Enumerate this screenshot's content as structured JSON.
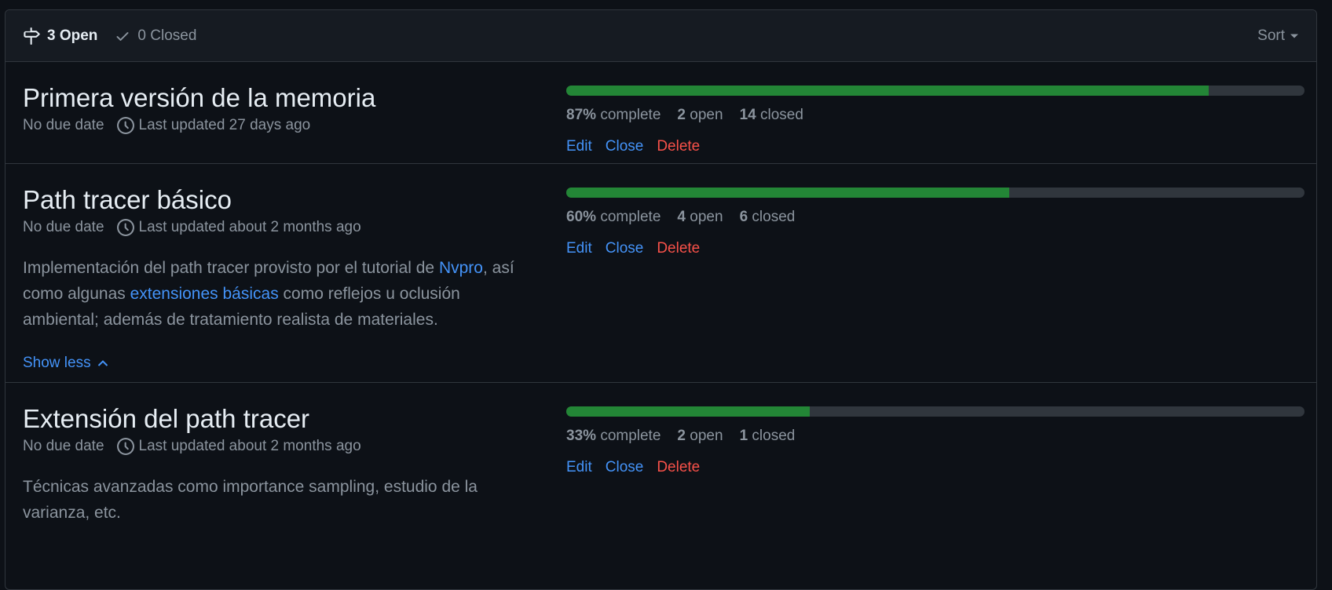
{
  "header": {
    "open_label": "3 Open",
    "closed_label": "0 Closed",
    "sort_label": "Sort"
  },
  "milestones": [
    {
      "title": "Primera versión de la memoria",
      "due": "No due date",
      "updated": "Last updated 27 days ago",
      "progress": 87,
      "complete_pct": "87%",
      "complete_word": "complete",
      "open_count": "2",
      "open_word": "open",
      "closed_count": "14",
      "closed_word": "closed",
      "edit": "Edit",
      "close": "Close",
      "delete": "Delete"
    },
    {
      "title": "Path tracer básico",
      "due": "No due date",
      "updated": "Last updated about 2 months ago",
      "progress": 60,
      "complete_pct": "60%",
      "complete_word": "complete",
      "open_count": "4",
      "open_word": "open",
      "closed_count": "6",
      "closed_word": "closed",
      "edit": "Edit",
      "close": "Close",
      "delete": "Delete",
      "desc_1": "Implementación del path tracer provisto por el tutorial de ",
      "desc_link_1": "Nvpro",
      "desc_2": ", así como algunas ",
      "desc_link_2": "extensiones básicas",
      "desc_3": " como reflejos u oclusión ambiental; además de tratamiento realista de materiales.",
      "show_less": "Show less"
    },
    {
      "title": "Extensión del path tracer",
      "due": "No due date",
      "updated": "Last updated about 2 months ago",
      "progress": 33,
      "complete_pct": "33%",
      "complete_word": "complete",
      "open_count": "2",
      "open_word": "open",
      "closed_count": "1",
      "closed_word": "closed",
      "edit": "Edit",
      "close": "Close",
      "delete": "Delete",
      "desc_1": "Técnicas avanzadas como importance sampling, estudio de la varianza, etc."
    }
  ],
  "colors": {
    "background": "#0d1117",
    "header_bg": "#161b22",
    "progress_fill": "#238636",
    "progress_track": "#30363d",
    "link": "#4493f8",
    "danger": "#f85149"
  },
  "icons": {
    "open": "milestone-icon",
    "closed": "check-icon",
    "sort": "caret-down-icon",
    "updated": "clock-icon",
    "show_less": "chevron-up-icon"
  }
}
